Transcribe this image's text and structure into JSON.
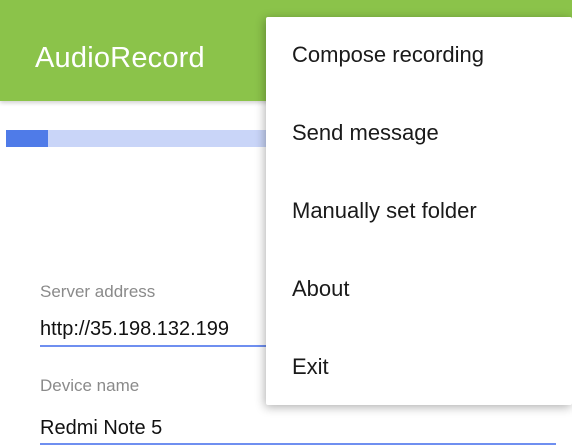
{
  "app_bar": {
    "title": "AudioRecord",
    "color": "#8bc34a"
  },
  "progress": {
    "fraction": 0.075,
    "track_color": "#c9d5f8",
    "fill_color": "#4f7be8"
  },
  "form": {
    "server_address": {
      "label": "Server address",
      "value": "http://35.198.132.199"
    },
    "device_name": {
      "label": "Device name",
      "value": "Redmi Note 5"
    }
  },
  "overflow_menu": {
    "items": [
      {
        "label": "Compose recording"
      },
      {
        "label": "Send message"
      },
      {
        "label": "Manually set folder"
      },
      {
        "label": "About"
      },
      {
        "label": "Exit"
      }
    ]
  }
}
